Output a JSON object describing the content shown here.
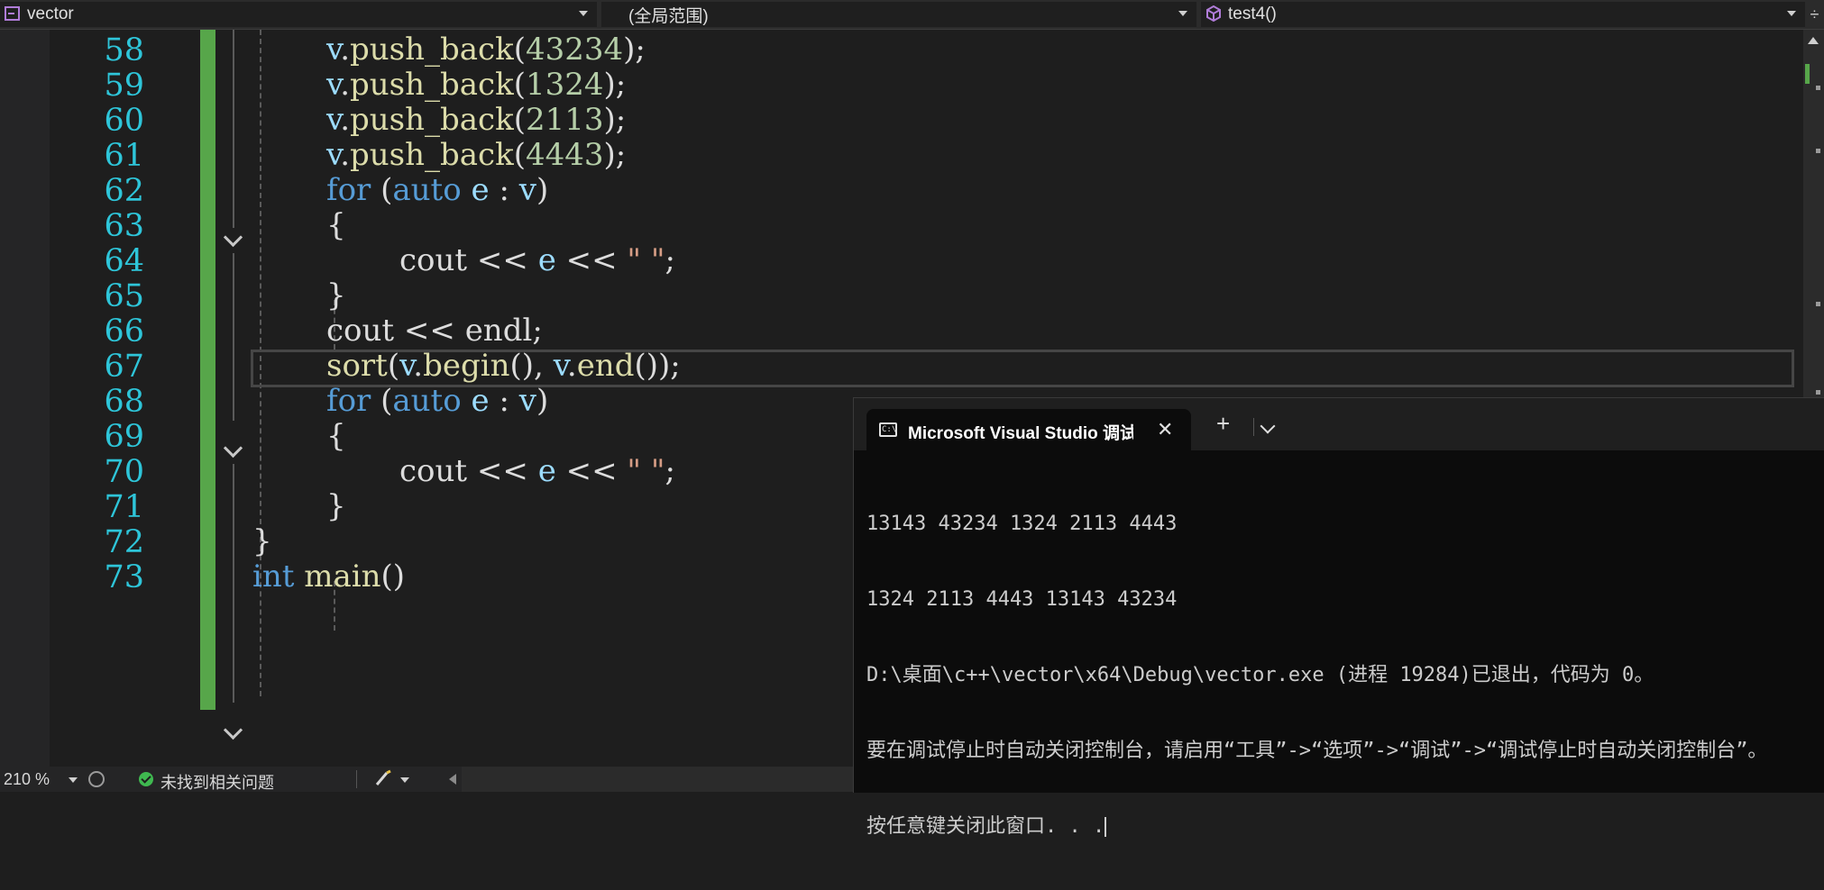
{
  "navbar": {
    "project": "vector",
    "scope": "(全局范围)",
    "function": "test4()"
  },
  "editor": {
    "lines": [
      {
        "n": "58"
      },
      {
        "n": "59"
      },
      {
        "n": "60"
      },
      {
        "n": "61"
      },
      {
        "n": "62"
      },
      {
        "n": "63"
      },
      {
        "n": "64"
      },
      {
        "n": "65"
      },
      {
        "n": "66"
      },
      {
        "n": "67"
      },
      {
        "n": "68"
      },
      {
        "n": "69"
      },
      {
        "n": "70"
      },
      {
        "n": "71"
      },
      {
        "n": "72"
      },
      {
        "n": "73"
      }
    ],
    "code": {
      "l58": {
        "obj": "v",
        "dot": ".",
        "fn": "push_back",
        "open": "(",
        "arg": "43234",
        "close": ");"
      },
      "l59": {
        "obj": "v",
        "dot": ".",
        "fn": "push_back",
        "open": "(",
        "arg": "1324",
        "close": ");"
      },
      "l60": {
        "obj": "v",
        "dot": ".",
        "fn": "push_back",
        "open": "(",
        "arg": "2113",
        "close": ");"
      },
      "l61": {
        "obj": "v",
        "dot": ".",
        "fn": "push_back",
        "open": "(",
        "arg": "4443",
        "close": ");"
      },
      "l62": {
        "kw": "for",
        "p1": " (",
        "auto": "auto",
        "e": " e ",
        "colon": ": ",
        "v": "v",
        "p2": ")"
      },
      "l63": "{",
      "l64": {
        "cout": "cout ",
        "op1": "<< ",
        "e": "e ",
        "op2": "<< ",
        "str": "\" \"",
        "end": ";"
      },
      "l65": "}",
      "l66": {
        "cout": "cout ",
        "op": "<< ",
        "endl": "endl",
        "end": ";"
      },
      "l67": {
        "fn": "sort",
        "open": "(",
        "v1": "v",
        "dot1": ".",
        "fn1": "begin",
        "mid": "(), ",
        "v2": "v",
        "dot2": ".",
        "fn2": "end",
        "close": "());"
      },
      "l68": {
        "kw": "for",
        "p1": " (",
        "auto": "auto",
        "e": " e ",
        "colon": ": ",
        "v": "v",
        "p2": ")"
      },
      "l69": "{",
      "l70": {
        "cout": "cout ",
        "op1": "<< ",
        "e": "e ",
        "op2": "<< ",
        "str": "\" \"",
        "end": ";"
      },
      "l71": "}",
      "l72": "}",
      "l73": {
        "kw": "int",
        "sp": " ",
        "fn": "main",
        "paren": "()"
      }
    }
  },
  "statusbar": {
    "zoom": "210 %",
    "issues": "未找到相关问题"
  },
  "console": {
    "tab_title": "Microsoft Visual Studio 调试控制台",
    "tab_icon_text": "C:\\",
    "close_glyph": "✕",
    "new_tab_glyph": "+",
    "lines": [
      "13143 43234 1324 2113 4443",
      "1324 2113 4443 13143 43234",
      "D:\\桌面\\c++\\vector\\x64\\Debug\\vector.exe (进程 19284)已退出，代码为 0。",
      "要在调试停止时自动关闭控制台，请启用“工具”->“选项”->“调试”->“调试停止时自动关闭控制台”。",
      "按任意键关闭此窗口. . ."
    ]
  },
  "colors": {
    "line_number": "#2ec5d9",
    "keyword": "#569cd6",
    "variable": "#9cdcfe",
    "function": "#dcdcaa",
    "number": "#b5cea8",
    "string": "#d69d85",
    "change_bar": "#57a64a",
    "console_bg": "#0c0c0c"
  }
}
